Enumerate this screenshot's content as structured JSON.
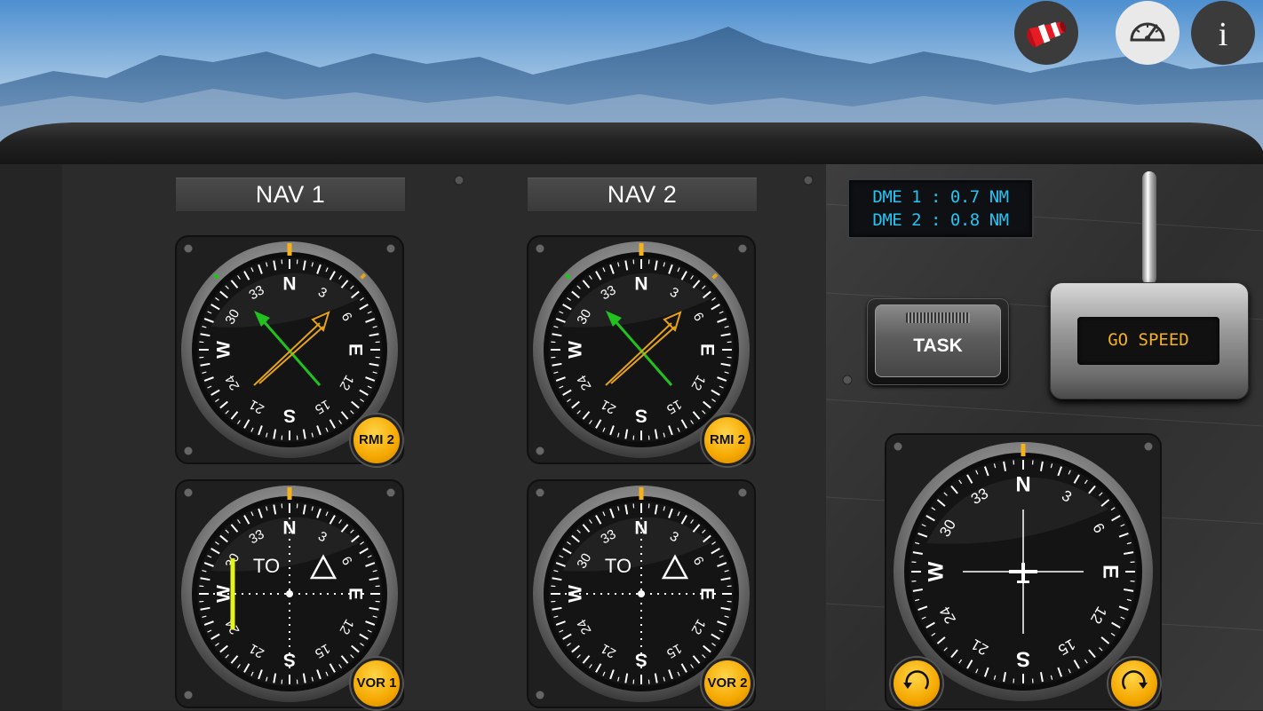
{
  "nav_headers": {
    "nav1": "NAV 1",
    "nav2": "NAV 2"
  },
  "dme": {
    "line1": "DME 1 : 0.7 NM",
    "line2": "DME 2 : 0.8 NM"
  },
  "buttons": {
    "task": "TASK",
    "go_speed": "GO SPEED"
  },
  "instruments": {
    "rmi1": {
      "label": "RMI 2"
    },
    "rmi2": {
      "label": "RMI 2"
    },
    "vor1": {
      "label": "VOR 1",
      "to_from": "TO"
    },
    "vor2": {
      "label": "VOR 2",
      "to_from": "TO"
    }
  },
  "compass_card": {
    "cardinals": [
      "N",
      "E",
      "S",
      "W"
    ],
    "numbers": [
      "3",
      "6",
      "12",
      "15",
      "21",
      "24",
      "30",
      "33"
    ]
  },
  "top_icons": [
    "windsock-icon",
    "speedometer-icon",
    "info-icon"
  ],
  "top_icon_info_text": "i",
  "colors": {
    "rmi_green_needle": "#22c21e",
    "rmi_orange_needle": "#e6a21a",
    "vor_cdi_needle": "#e3f51a",
    "dme_text": "#25c3f2",
    "go_speed_text": "#f5b21a",
    "button_orange": "#f5a800"
  }
}
